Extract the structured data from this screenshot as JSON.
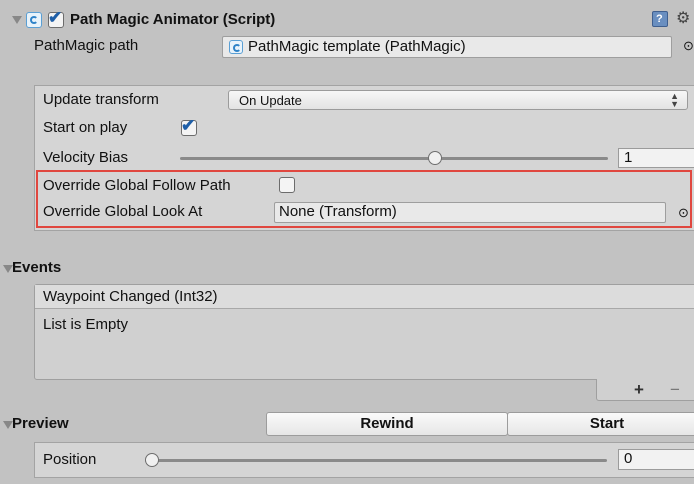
{
  "component": {
    "title": "Path Magic Animator (Script)",
    "enabled": true
  },
  "path_field": {
    "label": "PathMagic path",
    "value": "PathMagic template (PathMagic)"
  },
  "settings": {
    "update_transform_label": "Update transform",
    "update_transform_value": "On Update",
    "start_on_play_label": "Start on play",
    "start_on_play_checked": true,
    "velocity_bias_label": "Velocity Bias",
    "velocity_bias_value": "1",
    "velocity_bias_fraction": 0.6,
    "override_follow_label": "Override Global Follow Path",
    "override_follow_checked": false,
    "override_lookat_label": "Override Global Look At",
    "override_lookat_value": "None (Transform)"
  },
  "events": {
    "header": "Events",
    "event_name": "Waypoint Changed (Int32)",
    "list_empty_text": "List is Empty",
    "add_label": "+",
    "remove_label": "−"
  },
  "preview": {
    "header": "Preview",
    "rewind_label": "Rewind",
    "start_label": "Start",
    "position_label": "Position",
    "position_value": "0",
    "position_fraction": 0.0
  },
  "colors": {
    "highlight": "#e0473f",
    "checkbox_tick": "#1f5fa8"
  },
  "icons": [
    "foldout-arrow-icon",
    "script-icon",
    "help-book-icon",
    "gear-icon",
    "object-picker-icon",
    "dropdown-arrows-icon"
  ]
}
